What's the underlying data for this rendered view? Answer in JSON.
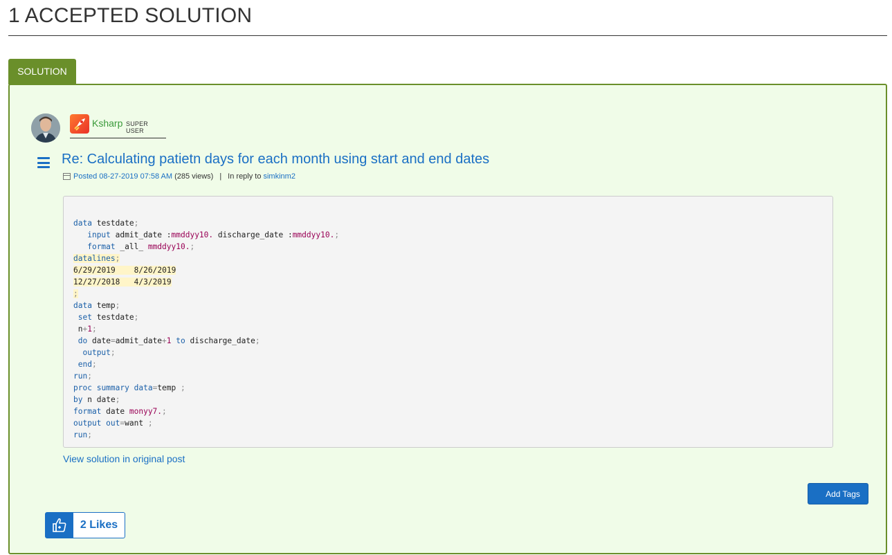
{
  "heading": "1 ACCEPTED SOLUTION",
  "solution_tab": "SOLUTION",
  "author": {
    "name": "Ksharp",
    "rank": "SUPER USER"
  },
  "post": {
    "title": "Re: Calculating patietn days for each month using start and end dates",
    "posted_label": "Posted",
    "posted_datetime": "08-27-2019 07:58 AM",
    "views": "(285 views)",
    "separator": "|",
    "in_reply_to_label": "In reply to",
    "in_reply_to_user": "simkinm2"
  },
  "code_lines": [
    "data testdate;",
    "   input admit_date :mmddyy10. discharge_date :mmddyy10.;",
    "   format _all_ mmddyy10.;",
    "datalines;",
    "6/29/2019    8/26/2019",
    "12/27/2018   4/3/2019",
    ";",
    "data temp;",
    " set testdate;",
    " n+1;",
    " do date=admit_date+1 to discharge_date;",
    "  output;",
    " end;",
    "run;",
    "proc summary data=temp ;",
    "by n date;",
    "format date monyy7.;",
    "output out=want ;",
    "run;"
  ],
  "view_solution_link": "View solution in original post",
  "add_tags_label": "Add Tags",
  "likes_label": "2 Likes",
  "colors": {
    "accent_green": "#6a8f2a",
    "box_bg": "#f0fce8",
    "link_blue": "#1a6fc4"
  },
  "icons": {
    "menu": "hamburger-menu-icon",
    "calendar": "calendar-icon",
    "rank": "rocket-rank-icon",
    "like": "thumbs-up-icon",
    "tag": "tag-icon"
  }
}
